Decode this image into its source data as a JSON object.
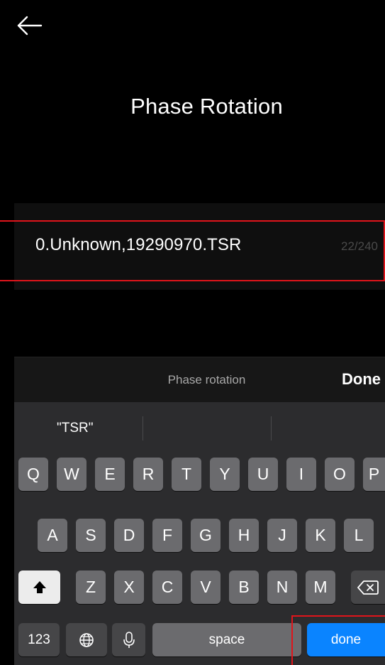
{
  "header": {
    "title": "Phase Rotation"
  },
  "field": {
    "value": "0.Unknown,19290970.TSR",
    "counter": "22/240"
  },
  "accessory": {
    "label": "Phase rotation",
    "done_label": "Done"
  },
  "suggestions": [
    "\"TSR\"",
    "",
    ""
  ],
  "keyboard": {
    "row1": [
      "Q",
      "W",
      "E",
      "R",
      "T",
      "Y",
      "U",
      "I",
      "O",
      "P"
    ],
    "row2": [
      "A",
      "S",
      "D",
      "F",
      "G",
      "H",
      "J",
      "K",
      "L"
    ],
    "row3": [
      "Z",
      "X",
      "C",
      "V",
      "B",
      "N",
      "M"
    ],
    "numbers_label": "123",
    "space_label": "space",
    "return_label": "done"
  },
  "colors": {
    "highlight": "#e0141b",
    "return_key": "#0a84ff"
  }
}
